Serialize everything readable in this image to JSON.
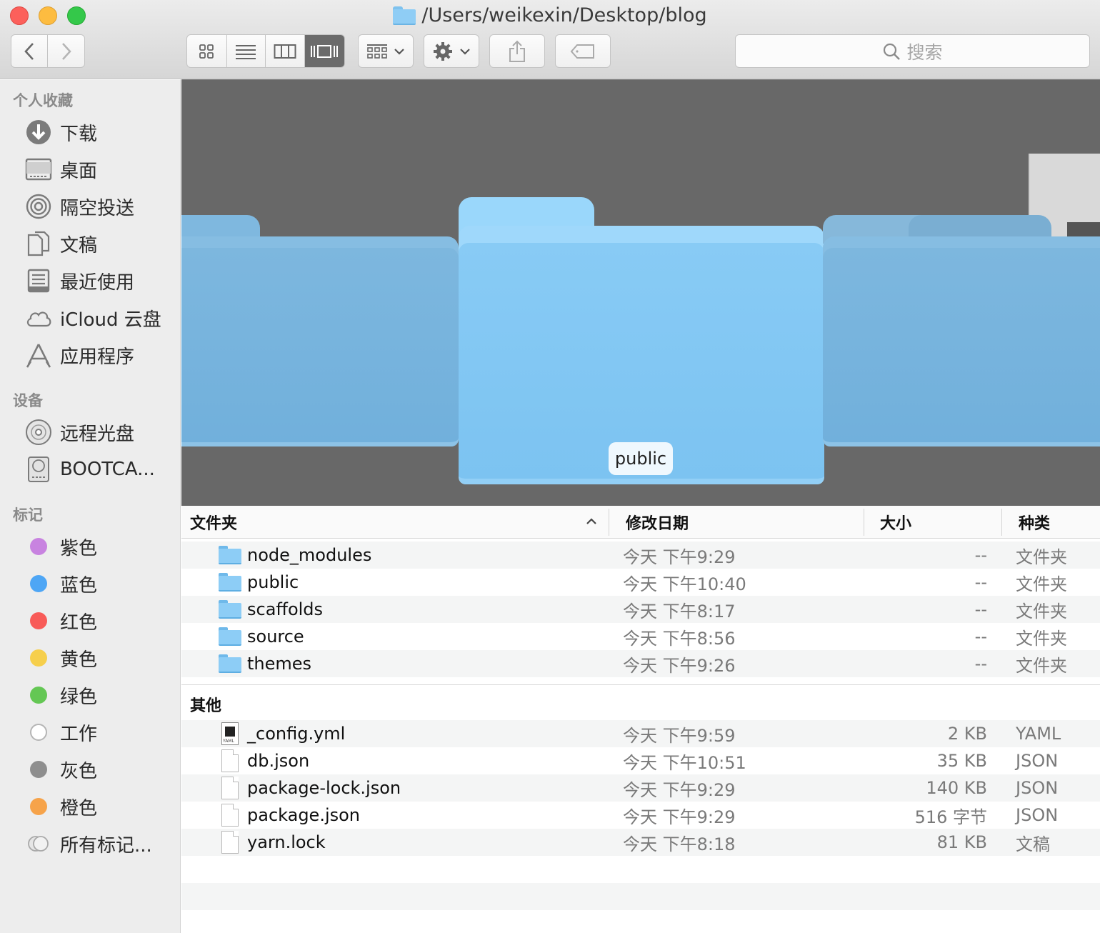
{
  "window": {
    "title": "/Users/weikexin/Desktop/blog",
    "search_placeholder": "搜索"
  },
  "colors": {
    "folder_blue": "#8dcdf6",
    "selected_view": "#6b6b6b",
    "sidebar_bg": "#ededed",
    "coverflow_bg": "#686868"
  },
  "toolbar": {
    "back_icon": "chevron-left-icon",
    "forward_icon": "chevron-right-icon",
    "view_modes": [
      "icon-view-icon",
      "list-view-icon",
      "column-view-icon",
      "coverflow-view-icon"
    ],
    "active_view": "coverflow-view-icon",
    "group_icon": "group-by-icon",
    "action_icon": "gear-icon",
    "share_icon": "share-icon",
    "tag_icon": "tag-icon"
  },
  "sidebar": {
    "favorites_header": "个人收藏",
    "favorites": [
      {
        "label": "下载",
        "icon": "download-icon"
      },
      {
        "label": "桌面",
        "icon": "desktop-icon"
      },
      {
        "label": "隔空投送",
        "icon": "airdrop-icon"
      },
      {
        "label": "文稿",
        "icon": "documents-icon"
      },
      {
        "label": "最近使用",
        "icon": "recents-icon"
      },
      {
        "label": "iCloud 云盘",
        "icon": "icloud-icon"
      },
      {
        "label": "应用程序",
        "icon": "applications-icon"
      }
    ],
    "devices_header": "设备",
    "devices": [
      {
        "label": "远程光盘",
        "icon": "remote-disc-icon"
      },
      {
        "label": "BOOTCA...",
        "icon": "disk-icon"
      }
    ],
    "tags_header": "标记",
    "tags": [
      {
        "label": "紫色",
        "color": "#c883e0"
      },
      {
        "label": "蓝色",
        "color": "#4ea6f5"
      },
      {
        "label": "红色",
        "color": "#f85b58"
      },
      {
        "label": "黄色",
        "color": "#f6cf4c"
      },
      {
        "label": "绿色",
        "color": "#64c754"
      },
      {
        "label": "工作",
        "color": "#ffffff"
      },
      {
        "label": "灰色",
        "color": "#8e8e8e"
      },
      {
        "label": "橙色",
        "color": "#f6a34a"
      },
      {
        "label": "所有标记...",
        "color": "all"
      }
    ]
  },
  "coverflow": {
    "selected_label": "public"
  },
  "list": {
    "columns": {
      "name": "文件夹",
      "date": "修改日期",
      "size": "大小",
      "kind": "种类",
      "sort_icon": "chevron-up-icon"
    },
    "folders": [
      {
        "name": "node_modules",
        "date": "今天 下午9:29",
        "size": "--",
        "kind": "文件夹"
      },
      {
        "name": "public",
        "date": "今天 下午10:40",
        "size": "--",
        "kind": "文件夹"
      },
      {
        "name": "scaffolds",
        "date": "今天 下午8:17",
        "size": "--",
        "kind": "文件夹"
      },
      {
        "name": "source",
        "date": "今天 下午8:56",
        "size": "--",
        "kind": "文件夹"
      },
      {
        "name": "themes",
        "date": "今天 下午9:26",
        "size": "--",
        "kind": "文件夹"
      }
    ],
    "other_header": "其他",
    "files": [
      {
        "name": "_config.yml",
        "date": "今天 下午9:59",
        "size": "2 KB",
        "kind": "YAML",
        "icon": "yaml-file-icon",
        "icon_text": "YAML"
      },
      {
        "name": "db.json",
        "date": "今天 下午10:51",
        "size": "35 KB",
        "kind": "JSON",
        "icon": "document-icon"
      },
      {
        "name": "package-lock.json",
        "date": "今天 下午9:29",
        "size": "140 KB",
        "kind": "JSON",
        "icon": "document-icon"
      },
      {
        "name": "package.json",
        "date": "今天 下午9:29",
        "size": "516 字节",
        "kind": "JSON",
        "icon": "document-icon"
      },
      {
        "name": "yarn.lock",
        "date": "今天 下午8:18",
        "size": "81 KB",
        "kind": "文稿",
        "icon": "document-icon"
      }
    ]
  }
}
